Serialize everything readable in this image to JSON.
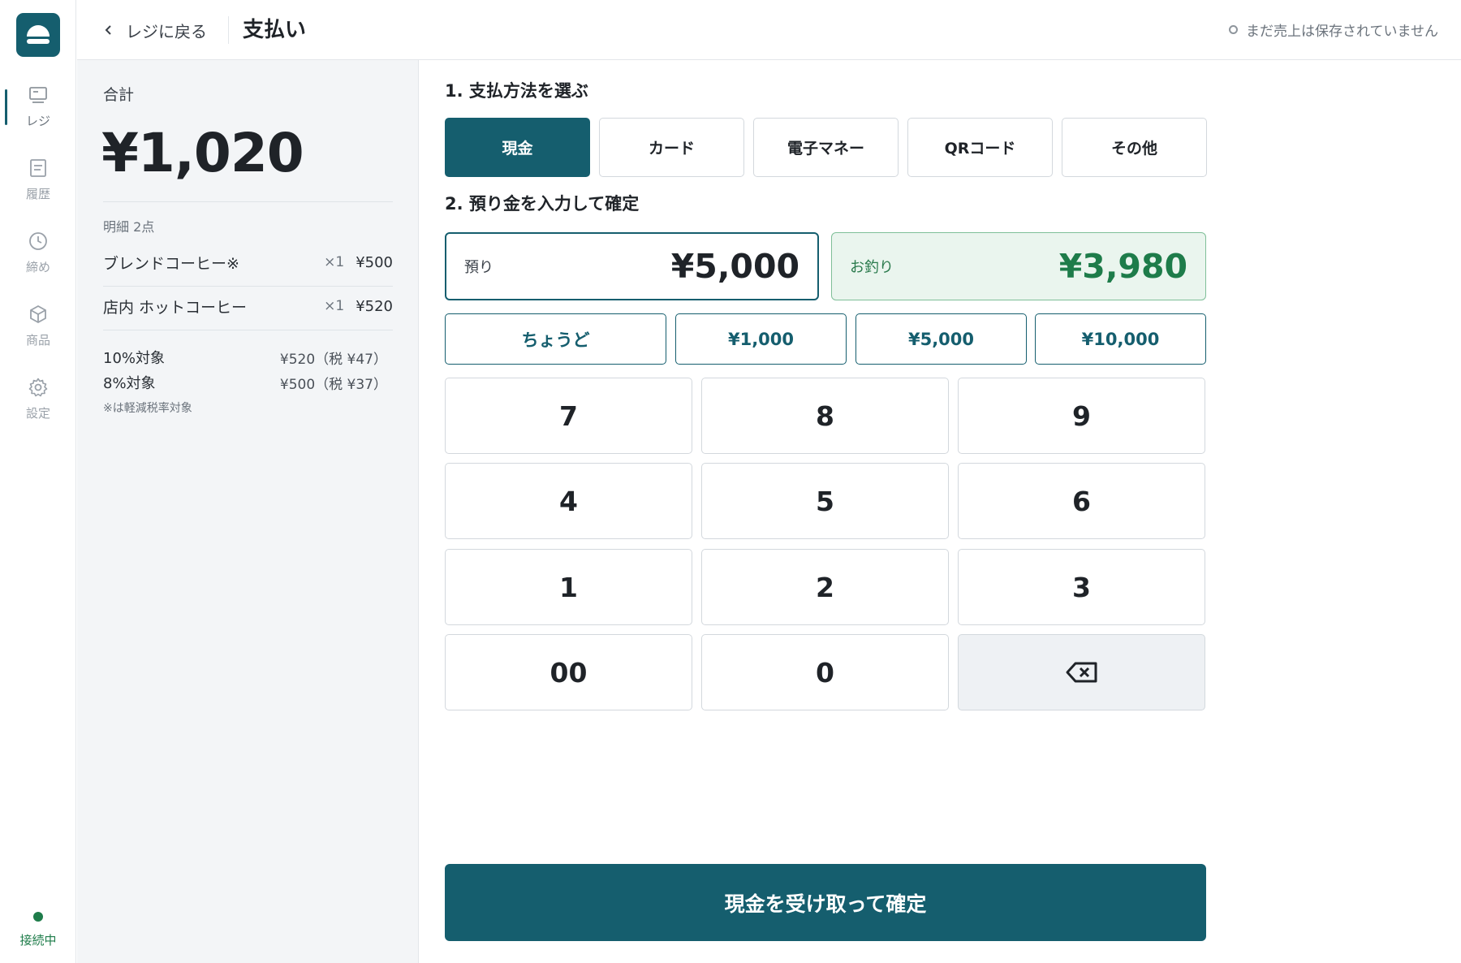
{
  "app": {
    "logo_icon": "register-logo-icon"
  },
  "sidebar": {
    "items": [
      {
        "label": "レジ",
        "icon": "register-icon",
        "active": true
      },
      {
        "label": "履歴",
        "icon": "history-icon",
        "active": false
      },
      {
        "label": "締め",
        "icon": "clock-icon",
        "active": false
      },
      {
        "label": "商品",
        "icon": "box-icon",
        "active": false
      },
      {
        "label": "設定",
        "icon": "gear-icon",
        "active": false
      }
    ],
    "connection_status": "接続中",
    "connection_color": "#1e7c4a"
  },
  "header": {
    "back_label": "レジに戻る",
    "title": "支払い",
    "save_status": "まだ売上は保存されていません"
  },
  "summary": {
    "total_label": "合計",
    "total": "¥1,020",
    "items_header": "明細 2点",
    "items": [
      {
        "name": "ブレンドコーヒー※",
        "qty": "×1",
        "price": "¥500"
      },
      {
        "name": "店内 ホットコーヒー",
        "qty": "×1",
        "price": "¥520"
      }
    ],
    "tax": [
      {
        "label": "10%対象",
        "value": "¥520（税 ¥47）"
      },
      {
        "label": "8%対象",
        "value": "¥500（税 ¥37）"
      }
    ],
    "note": "※は軽減税率対象"
  },
  "payment": {
    "step1_title": "1. 支払方法を選ぶ",
    "methods": [
      {
        "label": "現金",
        "selected": true
      },
      {
        "label": "カード",
        "selected": false
      },
      {
        "label": "電子マネー",
        "selected": false
      },
      {
        "label": "QRコード",
        "selected": false
      },
      {
        "label": "その他",
        "selected": false
      }
    ],
    "step2_title": "2. 預り金を入力して確定",
    "tendered_label": "預り",
    "tendered_value": "¥5,000",
    "change_label": "お釣り",
    "change_value": "¥3,980",
    "quick_amounts": [
      "ちょうど",
      "¥1,000",
      "¥5,000",
      "¥10,000"
    ],
    "keypad": [
      "7",
      "8",
      "9",
      "4",
      "5",
      "6",
      "1",
      "2",
      "3",
      "00",
      "0"
    ],
    "backspace_icon": "backspace-icon",
    "confirm_label": "現金を受け取って確定",
    "accent_color": "#155e6e"
  }
}
